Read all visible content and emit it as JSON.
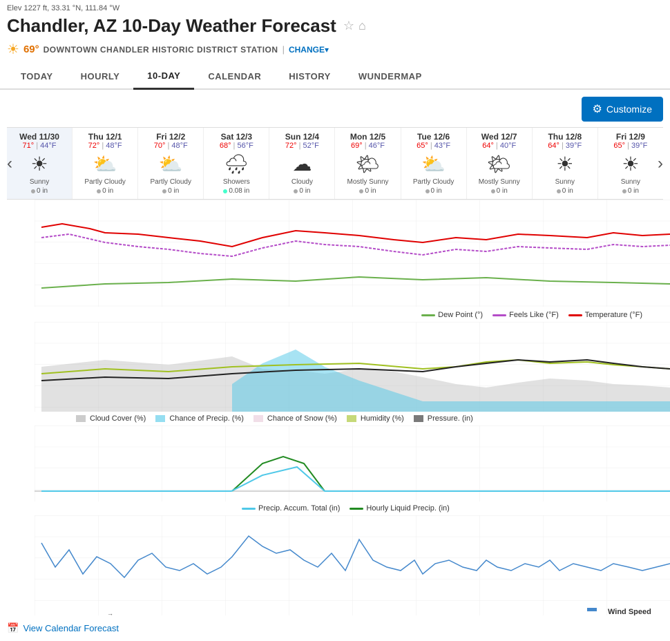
{
  "elevation": "Elev 1227 ft, 33.31 °N, 111.84 °W",
  "city_title": "Chandler, AZ 10-Day Weather Forecast",
  "temp": "69°",
  "station": "DOWNTOWN CHANDLER HISTORIC DISTRICT STATION",
  "change_label": "CHANGE",
  "tabs": [
    "TODAY",
    "HOURLY",
    "10-DAY",
    "CALENDAR",
    "HISTORY",
    "WUNDERMAP"
  ],
  "active_tab": "10-DAY",
  "customize_label": "Customize",
  "days": [
    {
      "name": "Wed 11/30",
      "high": "71°",
      "low": "44°F",
      "icon": "☀",
      "desc": "Sunny",
      "precip": "0 in",
      "rain": false
    },
    {
      "name": "Thu 12/1",
      "high": "72°",
      "low": "48°F",
      "icon": "⛅",
      "desc": "Partly Cloudy",
      "precip": "0 in",
      "rain": false
    },
    {
      "name": "Fri 12/2",
      "high": "70°",
      "low": "48°F",
      "icon": "⛅",
      "desc": "Partly Cloudy",
      "precip": "0 in",
      "rain": false
    },
    {
      "name": "Sat 12/3",
      "high": "68°",
      "low": "56°F",
      "icon": "🌧",
      "desc": "Showers",
      "precip": "0.08 in",
      "rain": true
    },
    {
      "name": "Sun 12/4",
      "high": "72°",
      "low": "52°F",
      "icon": "☁",
      "desc": "Cloudy",
      "precip": "0 in",
      "rain": false
    },
    {
      "name": "Mon 12/5",
      "high": "69°",
      "low": "46°F",
      "icon": "🌤",
      "desc": "Mostly Sunny",
      "precip": "0 in",
      "rain": false
    },
    {
      "name": "Tue 12/6",
      "high": "65°",
      "low": "43°F",
      "icon": "⛅",
      "desc": "Partly Cloudy",
      "precip": "0 in",
      "rain": false
    },
    {
      "name": "Wed 12/7",
      "high": "64°",
      "low": "40°F",
      "icon": "🌤",
      "desc": "Mostly Sunny",
      "precip": "0 in",
      "rain": false
    },
    {
      "name": "Thu 12/8",
      "high": "64°",
      "low": "39°F",
      "icon": "☀",
      "desc": "Sunny",
      "precip": "0 in",
      "rain": false
    },
    {
      "name": "Fri 12/9",
      "high": "65°",
      "low": "39°F",
      "icon": "☀",
      "desc": "Sunny",
      "precip": "0 in",
      "rain": false
    }
  ],
  "temp_chart_legend": [
    {
      "label": "Dew Point (°)",
      "color": "#6ab04c"
    },
    {
      "label": "Feels Like (°F)",
      "color": "#b44cc8"
    },
    {
      "label": "Temperature (°F)",
      "color": "#e00000"
    }
  ],
  "precip_chart_legend": [
    {
      "label": "Cloud Cover (%)",
      "color": "#aaa"
    },
    {
      "label": "Chance of Precip. (%)",
      "color": "#4fc8e8"
    },
    {
      "label": "Chance of Snow (%)",
      "color": "#e8c8d8"
    },
    {
      "label": "Humidity (%)",
      "color": "#a0c020"
    },
    {
      "label": "Pressure. (in)",
      "color": "#222"
    }
  ],
  "precip_accum_legend": [
    {
      "label": "Precip. Accum. Total (in)",
      "color": "#4fc8e8"
    },
    {
      "label": "Hourly Liquid Precip. (in)",
      "color": "#228b22"
    }
  ],
  "wind_legend": [
    {
      "label": "Wind Speed",
      "color": "#4488cc"
    }
  ],
  "view_calendar_label": "View Calendar Forecast"
}
